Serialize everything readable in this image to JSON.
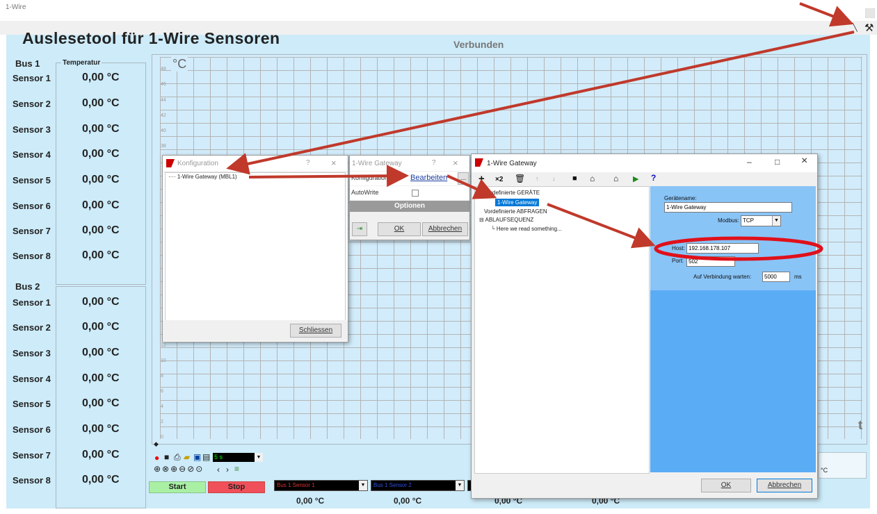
{
  "window": {
    "title": "1-Wire"
  },
  "app": {
    "title": "Auslesetool für 1-Wire Sensoren",
    "status": "Verbunden"
  },
  "bus1": {
    "label": "Bus 1",
    "legend": "Temperatur",
    "sensors": [
      {
        "name": "Sensor 1",
        "value": "0,00 °C"
      },
      {
        "name": "Sensor 2",
        "value": "0,00 °C"
      },
      {
        "name": "Sensor 3",
        "value": "0,00 °C"
      },
      {
        "name": "Sensor 4",
        "value": "0,00 °C"
      },
      {
        "name": "Sensor 5",
        "value": "0,00 °C"
      },
      {
        "name": "Sensor 6",
        "value": "0,00 °C"
      },
      {
        "name": "Sensor 7",
        "value": "0,00 °C"
      },
      {
        "name": "Sensor 8",
        "value": "0,00 °C"
      }
    ]
  },
  "bus2": {
    "label": "Bus 2",
    "sensors": [
      {
        "name": "Sensor 1",
        "value": "0,00 °C"
      },
      {
        "name": "Sensor 2",
        "value": "0,00 °C"
      },
      {
        "name": "Sensor 3",
        "value": "0,00 °C"
      },
      {
        "name": "Sensor 4",
        "value": "0,00 °C"
      },
      {
        "name": "Sensor 5",
        "value": "0,00 °C"
      },
      {
        "name": "Sensor 6",
        "value": "0,00 °C"
      },
      {
        "name": "Sensor 7",
        "value": "0,00 °C"
      },
      {
        "name": "Sensor 8",
        "value": "0,00 °C"
      }
    ]
  },
  "chart": {
    "y_unit": "°C",
    "x_unit": "t",
    "y_ticks": [
      "48",
      "46",
      "44",
      "42",
      "40",
      "38",
      "12",
      "10",
      "8",
      "6",
      "4",
      "2",
      "0"
    ]
  },
  "toolbar": {
    "interval": "5 s"
  },
  "controls": {
    "start": "Start",
    "stop": "Stop",
    "selects": [
      "Bus 1 Sensor 1",
      "Bus 1 Sensor 2"
    ],
    "values": [
      "0,00 °C",
      "0,00 °C",
      "0,00 °C",
      "0,00 °C"
    ],
    "partial_value": "°C"
  },
  "konfig": {
    "title": "Konfiguration",
    "help": "?",
    "close": "×",
    "tree_item": "1-Wire Gateway (MBL1)",
    "button": "Schliessen"
  },
  "gateway_small": {
    "title": "1-Wire Gateway",
    "help": "?",
    "close": "×",
    "row1_label": "Konfiguration",
    "row1_link": "Bearbeiten",
    "row1_dots": "...",
    "row2_label": "AutoWrite",
    "section": "Optionen",
    "ok": "OK",
    "cancel": "Abbrechen"
  },
  "gateway_big": {
    "title": "1-Wire Gateway",
    "minimize": "–",
    "maximize": "□",
    "close": "×",
    "toolbar": {
      "x2": "×2",
      "help": "?"
    },
    "tree": {
      "root1": "Vordefinierte GERÄTE",
      "child1": "1-Wire Gateway",
      "root2": "Vordefinierte ABFRAGEN",
      "root3": "ABLAUFSEQUENZ",
      "child3": "Here we read something..."
    },
    "form": {
      "device_name_label": "Gerätename:",
      "device_name": "1-Wire Gateway",
      "modbus_label": "Modbus:",
      "modbus": "TCP",
      "host_label": "Host:",
      "host": "192.168.178.107",
      "port_label": "Port:",
      "port": "502",
      "wait_label": "Auf Verbindung warten:",
      "wait": "5000",
      "wait_unit": "ms"
    },
    "ok": "OK",
    "cancel": "Abbrechen"
  },
  "colors": {
    "panel_bg": "#cdebf9",
    "grid": "#b4b4b4",
    "start": "#a9f0a4",
    "stop": "#f0505a",
    "annotation": "#c0392b",
    "form_panel": "#5aacf5",
    "selection": "#0078d7"
  }
}
